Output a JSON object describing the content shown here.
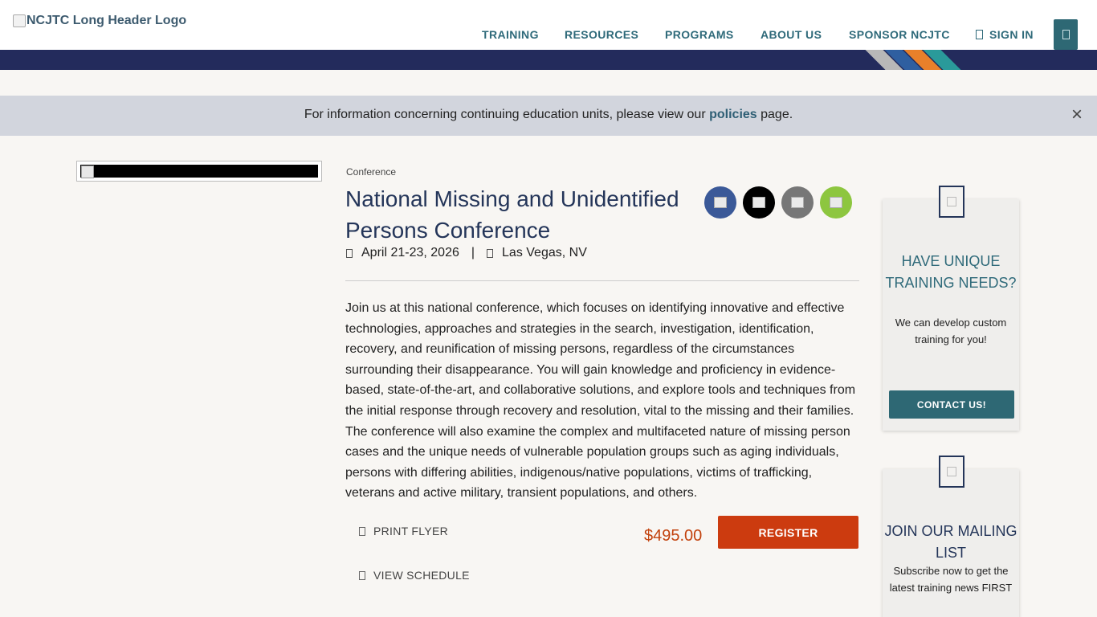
{
  "header": {
    "logo_alt": "NCJTC Long Header Logo",
    "nav": [
      {
        "label": "TRAINING"
      },
      {
        "label": "RESOURCES"
      },
      {
        "label": "PROGRAMS"
      },
      {
        "label": "ABOUT US"
      },
      {
        "label": "SPONSOR NCJTC"
      },
      {
        "label": "SIGN IN",
        "icon": "user-icon"
      }
    ],
    "menu_icon": "menu-icon",
    "band_stripe_colors": [
      "#b8b8b8",
      "#2f5fa0",
      "#e8802a",
      "#2a9a9a"
    ]
  },
  "alert": {
    "text_before": "For information concerning continuing education units, please view our ",
    "link": "policies",
    "text_after": " page.",
    "close": "×"
  },
  "event": {
    "category": "Conference",
    "title": "National Missing and Unidentified Persons Conference",
    "date": "April 21-23, 2026",
    "date_icon": "calendar-icon",
    "separator": "|",
    "location": "Las Vegas, NV",
    "location_icon": "map-pin-icon",
    "description": "Join us at this national conference, which focuses on identifying innovative and effective technologies, approaches and strategies in the search, investigation, identification, recovery, and reunification of missing persons, regardless of the circumstances surrounding their disappearance. You will gain knowledge and proficiency in evidence-based, state-of-the-art, and collaborative solutions, and explore tools and techniques from the initial response through recovery and resolution, vital to the missing and their families. The conference will also examine the complex and multifaceted nature of missing person cases and the unique needs of vulnerable population groups such as aging individuals, persons with differing abilities, indigenous/native populations, victims of trafficking, veterans and active military, transient populations, and others.",
    "print_flyer": "PRINT FLYER",
    "view_schedule": "VIEW SCHEDULE",
    "price": "$495.00",
    "register": "REGISTER",
    "social": [
      {
        "icon": "facebook-icon",
        "color": "#3b5998"
      },
      {
        "icon": "x-icon",
        "color": "#000000"
      },
      {
        "icon": "email-icon",
        "color": "#777777"
      },
      {
        "icon": "share-icon",
        "color": "#8dc63f"
      }
    ]
  },
  "sidebar": {
    "card1": {
      "title": "HAVE UNIQUE TRAINING NEEDS?",
      "text": "We can develop custom training for you!",
      "button": "CONTACT US!",
      "title_color": "#2f6a7a"
    },
    "card2": {
      "title": "JOIN OUR MAILING LIST",
      "text": "Subscribe now to get the latest training news FIRST",
      "title_color": "#243559"
    }
  }
}
